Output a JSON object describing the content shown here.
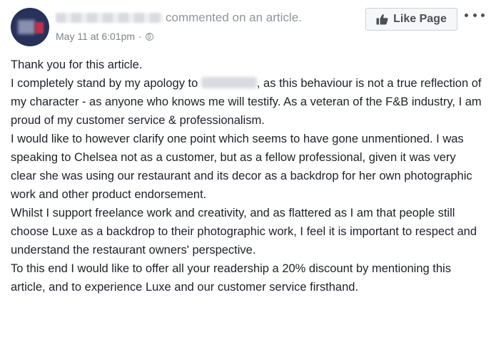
{
  "post": {
    "header_text": "commented on an article.",
    "timestamp": "May 11 at 6:01pm",
    "separator": "·",
    "privacy_icon": "globe-icon",
    "like_page_label": "Like Page",
    "like_icon": "thumbs-up-icon",
    "more_icon": "more-options-icon",
    "body": {
      "p1": "Thank you for this article.",
      "p2_before": "I completely stand by my apology to ",
      "p2_after": ", as this behaviour is not a true reflection of my character - as anyone who knows me will testify. As a veteran of the F&B industry, I am proud of my customer service & professionalism.",
      "p3": "I would like to however clarify one point which seems to have gone unmentioned. I was speaking to Chelsea not as a customer, but as a fellow professional, given it was very clear she was using our restaurant and its decor as a backdrop for her own photographic work and other product endorsement.",
      "p4": "Whilst I support freelance work and creativity, and as flattered as I am that people still choose Luxe as a backdrop to their photographic work, I feel it is important to respect and understand the restaurant owners' perspective.",
      "p5": "To this end I would like to offer all your readership a 20% discount by mentioning this article, and to experience Luxe and our customer service firsthand."
    }
  },
  "colors": {
    "text": "#1d2129",
    "meta": "#90949c",
    "button_bg": "#f6f7f9",
    "button_border": "#ced0d4",
    "avatar_bg": "#27315a"
  }
}
